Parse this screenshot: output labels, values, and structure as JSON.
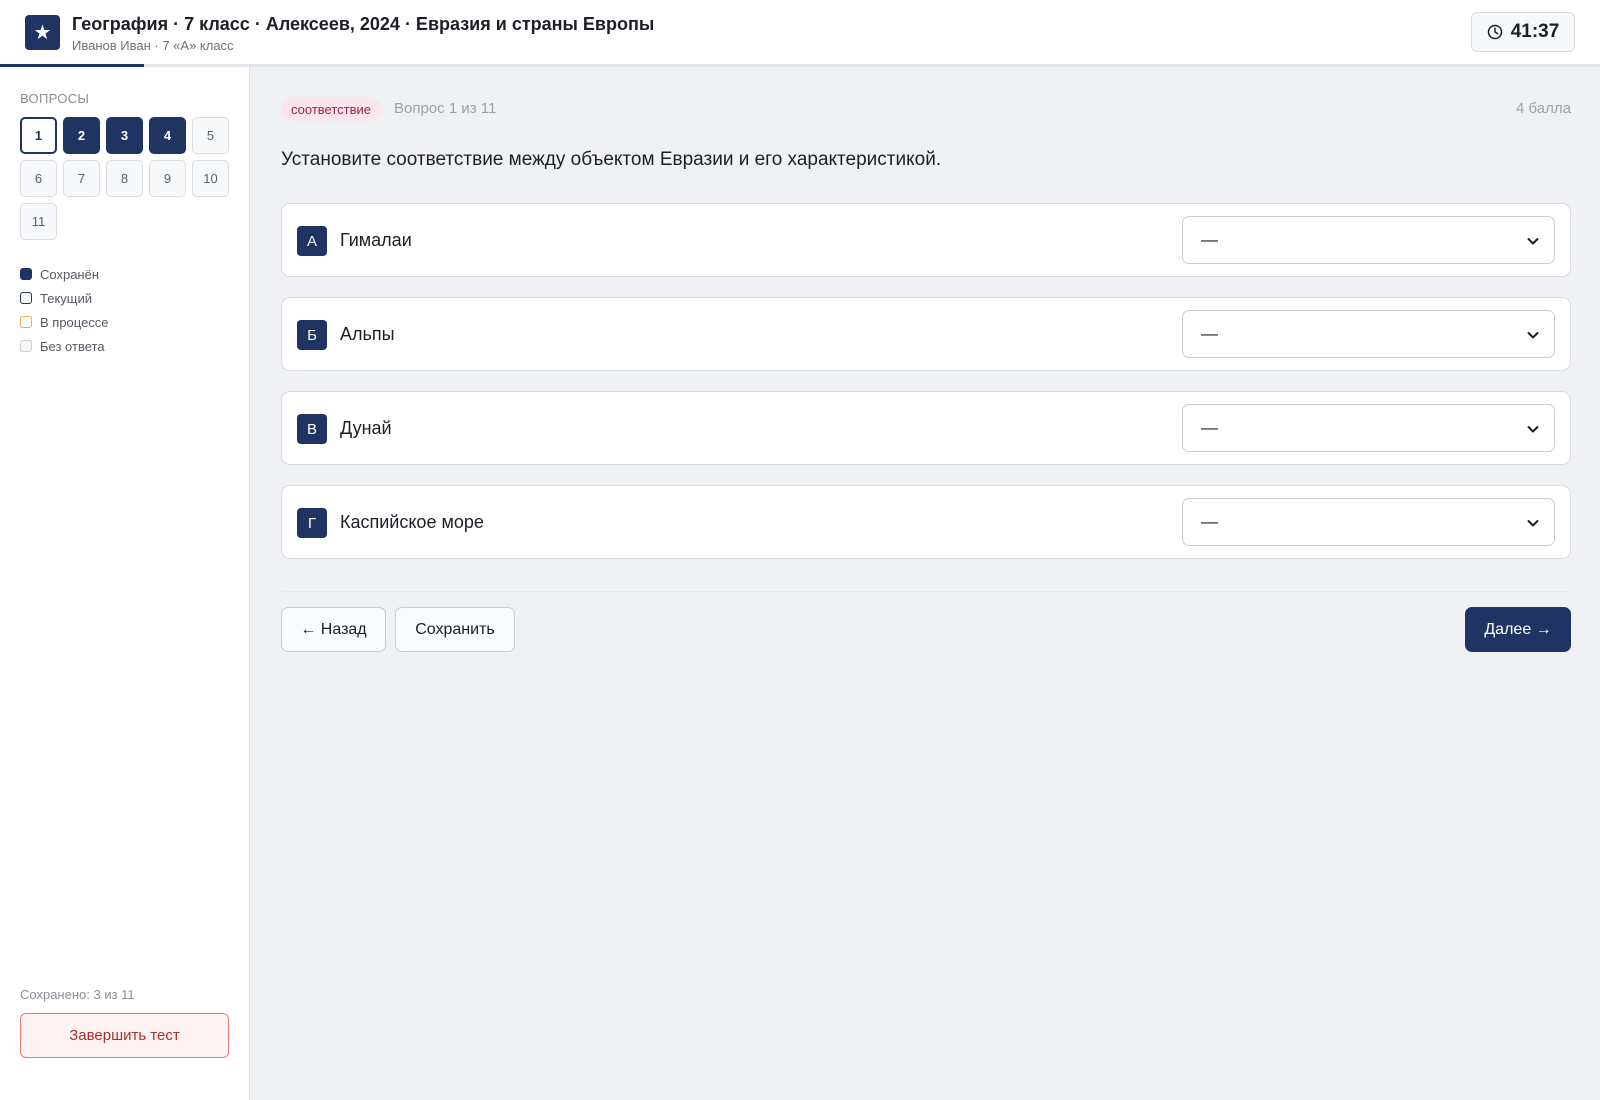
{
  "header": {
    "logo_glyph": "★",
    "title": "География · 7 класс · Алексеев, 2024 · Евразия и страны Европы",
    "subtitle": "Иванов Иван · 7 «А» класс",
    "timer": "41:37",
    "progress_fraction": 0.09
  },
  "sidebar": {
    "heading": "Вопросы",
    "questions": [
      {
        "label": "1",
        "state": "current"
      },
      {
        "label": "2",
        "state": "saved"
      },
      {
        "label": "3",
        "state": "saved"
      },
      {
        "label": "4",
        "state": "saved"
      },
      {
        "label": "5",
        "state": "empty"
      },
      {
        "label": "6",
        "state": "empty"
      },
      {
        "label": "7",
        "state": "empty"
      },
      {
        "label": "8",
        "state": "empty"
      },
      {
        "label": "9",
        "state": "empty"
      },
      {
        "label": "10",
        "state": "empty"
      },
      {
        "label": "11",
        "state": "empty"
      }
    ],
    "legend": {
      "saved": "Сохранён",
      "current": "Текущий",
      "in_progress": "В процессе",
      "empty": "Без ответа"
    },
    "saved_count": "Сохранено: 3 из 11",
    "finish_label": "Завершить тест"
  },
  "question": {
    "type_tag": "соответствие",
    "number_text": "Вопрос 1 из 11",
    "points": "4 балла",
    "text": "Установите соответствие между объектом Евразии и его характеристикой.",
    "items": [
      {
        "letter": "А",
        "label": "Гималаи",
        "selected": "—"
      },
      {
        "letter": "Б",
        "label": "Альпы",
        "selected": "—"
      },
      {
        "letter": "В",
        "label": "Дунай",
        "selected": "—"
      },
      {
        "letter": "Г",
        "label": "Каспийское море",
        "selected": "—"
      }
    ]
  },
  "nav": {
    "back_label": "← Назад",
    "save_label": "Сохранить",
    "next_label": "Далее →"
  },
  "colors": {
    "primary": "#1f3462",
    "tag_bg": "#fbe6ec",
    "tag_text": "#a0214b",
    "finish_border": "#e37b7b",
    "in_progress_border": "#e9b040"
  }
}
